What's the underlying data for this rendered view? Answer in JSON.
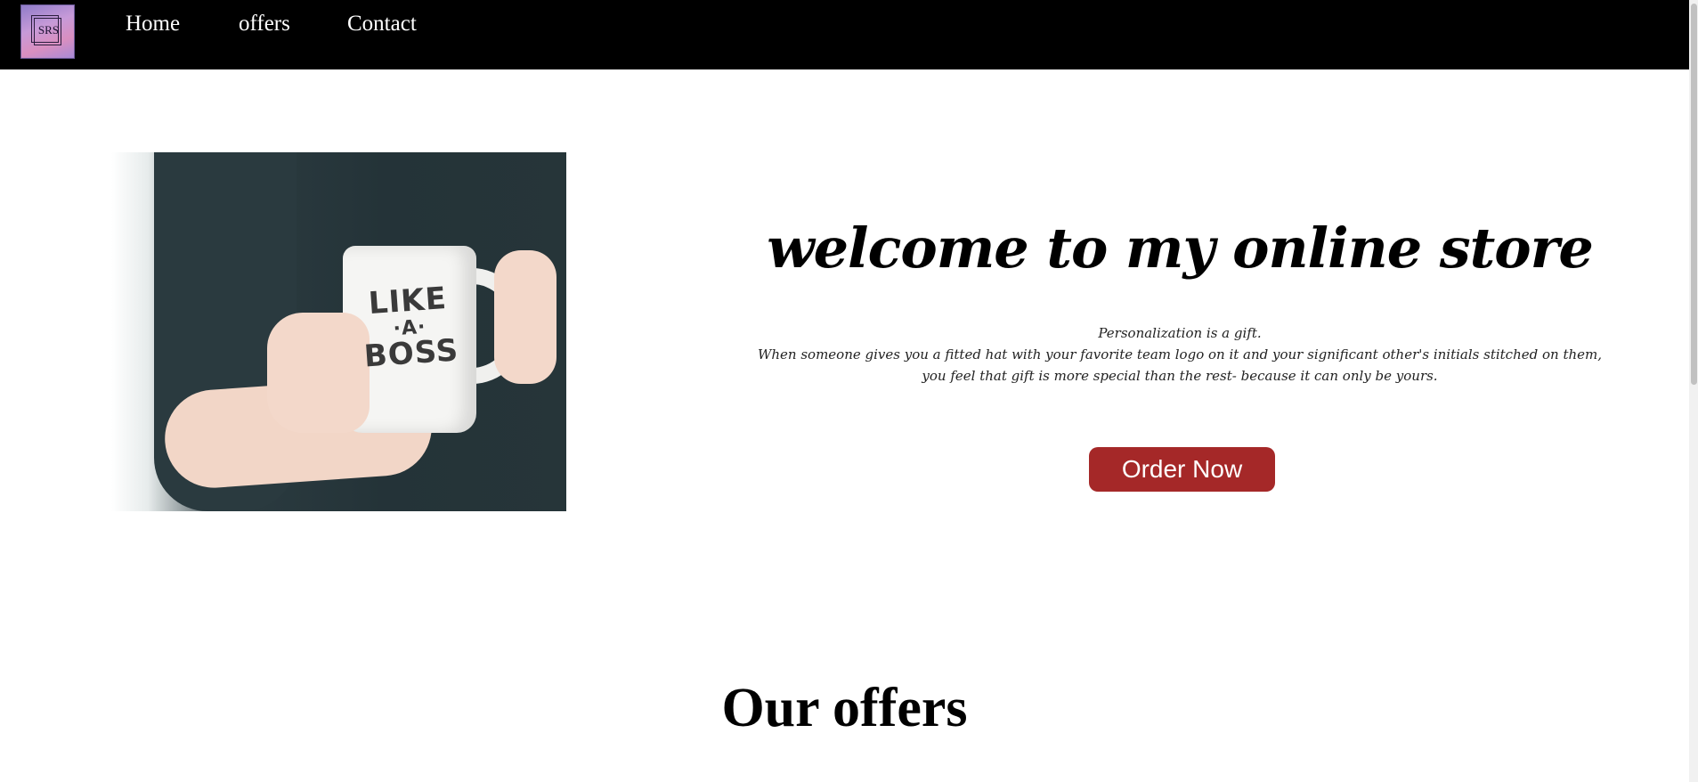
{
  "nav": {
    "logo_text": "SRS",
    "links": [
      {
        "label": "Home"
      },
      {
        "label": "offers"
      },
      {
        "label": "Contact"
      }
    ]
  },
  "hero": {
    "image_text": {
      "line1": "LIKE",
      "line2": "·A·",
      "line3": "BOSS"
    },
    "title": "welcome to my online store",
    "description": [
      "Personalization is a gift.",
      "When someone gives you a fitted hat with your favorite team logo on it and your significant other's initials stitched on them,",
      "you feel that gift is more special than the rest- because it can only be yours."
    ],
    "order_button_label": "Order Now"
  },
  "offers": {
    "heading": "Our offers"
  },
  "colors": {
    "nav_background": "#000000",
    "button_background": "#a52828",
    "button_text": "#ffffff"
  }
}
